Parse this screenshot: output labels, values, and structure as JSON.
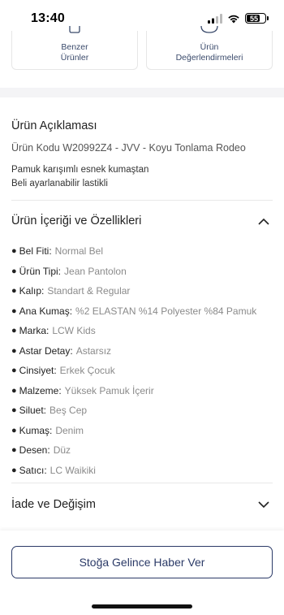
{
  "status_bar": {
    "time": "13:40",
    "battery": "55"
  },
  "cards": [
    {
      "label_line1": "Benzer",
      "label_line2": "Ürünler",
      "icon": "bag-icon"
    },
    {
      "label_line1": "Ürün",
      "label_line2": "Değerlendirmeleri",
      "icon": "review-icon"
    }
  ],
  "description": {
    "title": "Ürün Açıklaması",
    "code": "Ürün Kodu W20992Z4 - JVV - Koyu Tonlama Rodeo",
    "line1": "Pamuk karışımlı esnek kumaştan",
    "line2": "Beli ayarlanabilir lastikli"
  },
  "features": {
    "title": "Ürün İçeriği ve Özellikleri",
    "expanded": true,
    "items": [
      {
        "key": "Bel Fiti:",
        "value": "Normal Bel"
      },
      {
        "key": "Ürün Tipi:",
        "value": "Jean Pantolon"
      },
      {
        "key": "Kalıp:",
        "value": "Standart & Regular"
      },
      {
        "key": "Ana Kumaş:",
        "value": "%2 ELASTAN %14 Polyester %84 Pamuk"
      },
      {
        "key": "Marka:",
        "value": "LCW Kids"
      },
      {
        "key": "Astar Detay:",
        "value": "Astarsız"
      },
      {
        "key": "Cinsiyet:",
        "value": "Erkek Çocuk"
      },
      {
        "key": "Malzeme:",
        "value": "Yüksek Pamuk İçerir"
      },
      {
        "key": "Siluet:",
        "value": "Beş Cep"
      },
      {
        "key": "Kumaş:",
        "value": "Denim"
      },
      {
        "key": "Desen:",
        "value": "Düz"
      },
      {
        "key": "Satıcı:",
        "value": "LC Waikiki"
      }
    ]
  },
  "returns": {
    "title": "İade ve Değişim",
    "expanded": false
  },
  "notify_button": {
    "label": "Stoğa Gelince Haber Ver"
  },
  "colors": {
    "accent": "#2b3a67",
    "muted": "#8a8a8a"
  }
}
